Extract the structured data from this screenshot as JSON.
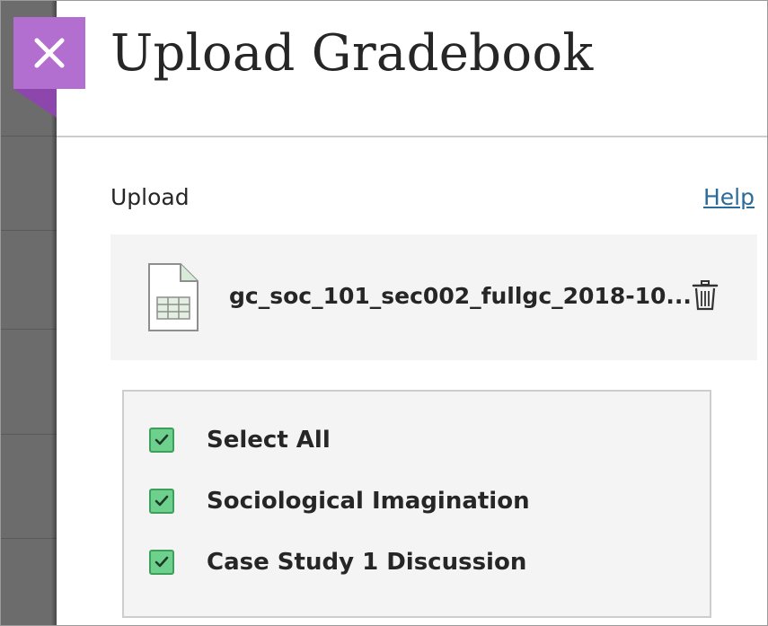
{
  "dialog": {
    "title": "Upload Gradebook",
    "close_icon": "close-icon"
  },
  "upload": {
    "label": "Upload",
    "help_link": "Help",
    "file": {
      "name": "gc_soc_101_sec002_fullgc_2018-10...",
      "icon": "spreadsheet-file-icon",
      "delete_icon": "trash-icon"
    }
  },
  "options": {
    "items": [
      {
        "label": "Select All",
        "checked": true
      },
      {
        "label": "Sociological Imagination",
        "checked": true
      },
      {
        "label": "Case Study 1 Discussion",
        "checked": true
      }
    ]
  },
  "colors": {
    "accent": "#b36fcf",
    "accent_dark": "#8d47ac",
    "checkbox": "#6ed08d",
    "link": "#2b6b9a"
  }
}
